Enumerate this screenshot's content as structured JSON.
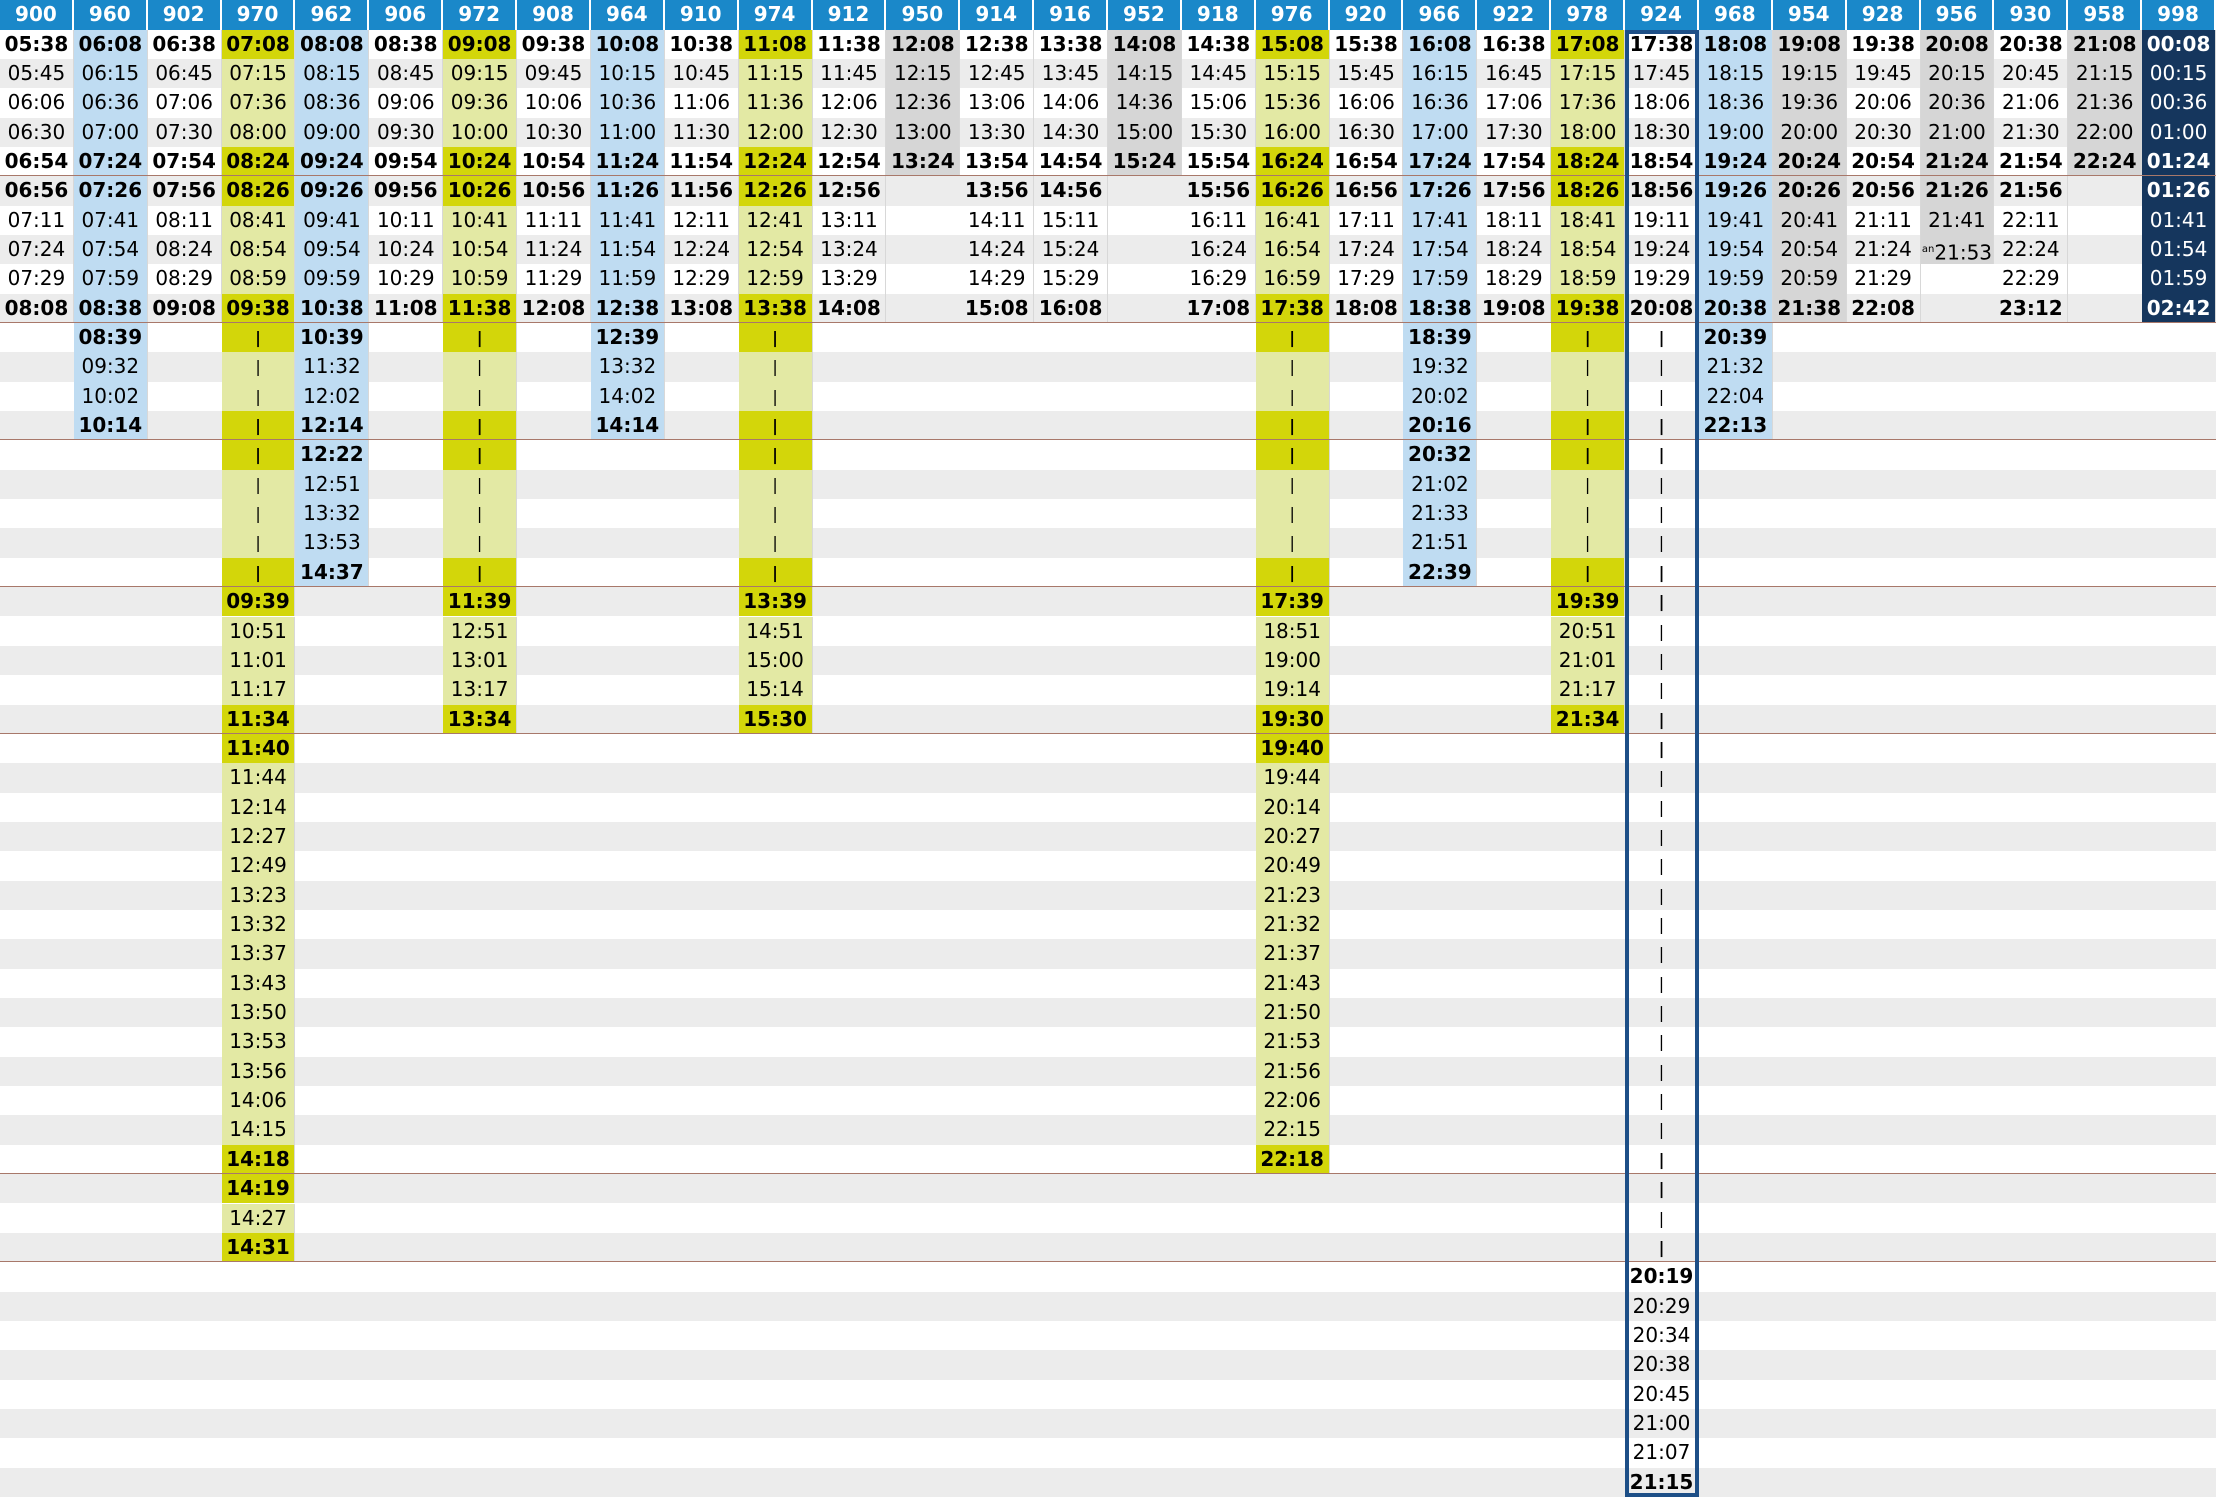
{
  "headers": [
    "900",
    "960",
    "902",
    "970",
    "962",
    "906",
    "972",
    "908",
    "964",
    "910",
    "974",
    "912",
    "950",
    "914",
    "916",
    "952",
    "918",
    "976",
    "920",
    "966",
    "922",
    "978",
    "924",
    "968",
    "954",
    "928",
    "956",
    "930",
    "958",
    "998"
  ],
  "column_styles": {
    "970": "yellow",
    "972": "yellow",
    "974": "yellow",
    "976": "yellow",
    "978": "yellow",
    "960": "lightblue",
    "962": "lightblue",
    "964": "lightblue",
    "966": "lightblue",
    "968": "lightblue",
    "950": "grey",
    "952": "grey",
    "954": "grey",
    "956": "grey",
    "958": "grey",
    "998": "navy"
  },
  "highlighted_column": "924",
  "colors": {
    "header_bg": "#1a88c9",
    "yellow_bold": "#d3d60a",
    "yellow_light": "#e3e9a4",
    "light_blue": "#bfdcf2",
    "grey": "#d6d6d6",
    "navy": "#15365d",
    "stripe": "#ececec",
    "separator": "#a8786a",
    "highlight_border": "#1d4f87"
  },
  "notes": {
    "an": "an"
  },
  "groups": [
    {
      "bold_last": true,
      "rows": [
        {
          "bold": true,
          "cells": {
            "900": "05:38",
            "960": "06:08",
            "902": "06:38",
            "970": "07:08",
            "962": "08:08",
            "906": "08:38",
            "972": "09:08",
            "908": "09:38",
            "964": "10:08",
            "910": "10:38",
            "974": "11:08",
            "912": "11:38",
            "950": "12:08",
            "914": "12:38",
            "916": "13:38",
            "952": "14:08",
            "918": "14:38",
            "976": "15:08",
            "920": "15:38",
            "966": "16:08",
            "922": "16:38",
            "978": "17:08",
            "924": "17:38",
            "968": "18:08",
            "954": "19:08",
            "928": "19:38",
            "956": "20:08",
            "930": "20:38",
            "958": "21:08",
            "998": "00:08"
          }
        },
        {
          "cells": {
            "900": "05:45",
            "960": "06:15",
            "902": "06:45",
            "970": "07:15",
            "962": "08:15",
            "906": "08:45",
            "972": "09:15",
            "908": "09:45",
            "964": "10:15",
            "910": "10:45",
            "974": "11:15",
            "912": "11:45",
            "950": "12:15",
            "914": "12:45",
            "916": "13:45",
            "952": "14:15",
            "918": "14:45",
            "976": "15:15",
            "920": "15:45",
            "966": "16:15",
            "922": "16:45",
            "978": "17:15",
            "924": "17:45",
            "968": "18:15",
            "954": "19:15",
            "928": "19:45",
            "956": "20:15",
            "930": "20:45",
            "958": "21:15",
            "998": "00:15"
          }
        },
        {
          "cells": {
            "900": "06:06",
            "960": "06:36",
            "902": "07:06",
            "970": "07:36",
            "962": "08:36",
            "906": "09:06",
            "972": "09:36",
            "908": "10:06",
            "964": "10:36",
            "910": "11:06",
            "974": "11:36",
            "912": "12:06",
            "950": "12:36",
            "914": "13:06",
            "916": "14:06",
            "952": "14:36",
            "918": "15:06",
            "976": "15:36",
            "920": "16:06",
            "966": "16:36",
            "922": "17:06",
            "978": "17:36",
            "924": "18:06",
            "968": "18:36",
            "954": "19:36",
            "928": "20:06",
            "956": "20:36",
            "930": "21:06",
            "958": "21:36",
            "998": "00:36"
          }
        },
        {
          "cells": {
            "900": "06:30",
            "960": "07:00",
            "902": "07:30",
            "970": "08:00",
            "962": "09:00",
            "906": "09:30",
            "972": "10:00",
            "908": "10:30",
            "964": "11:00",
            "910": "11:30",
            "974": "12:00",
            "912": "12:30",
            "950": "13:00",
            "914": "13:30",
            "916": "14:30",
            "952": "15:00",
            "918": "15:30",
            "976": "16:00",
            "920": "16:30",
            "966": "17:00",
            "922": "17:30",
            "978": "18:00",
            "924": "18:30",
            "968": "19:00",
            "954": "20:00",
            "928": "20:30",
            "956": "21:00",
            "930": "21:30",
            "958": "22:00",
            "998": "01:00"
          }
        },
        {
          "bold": true,
          "cells": {
            "900": "06:54",
            "960": "07:24",
            "902": "07:54",
            "970": "08:24",
            "962": "09:24",
            "906": "09:54",
            "972": "10:24",
            "908": "10:54",
            "964": "11:24",
            "910": "11:54",
            "974": "12:24",
            "912": "12:54",
            "950": "13:24",
            "914": "13:54",
            "916": "14:54",
            "952": "15:24",
            "918": "15:54",
            "976": "16:24",
            "920": "16:54",
            "966": "17:24",
            "922": "17:54",
            "978": "18:24",
            "924": "18:54",
            "968": "19:24",
            "954": "20:24",
            "928": "20:54",
            "956": "21:24",
            "930": "21:54",
            "958": "22:24",
            "998": "01:24"
          }
        }
      ]
    },
    {
      "rows": [
        {
          "bold": true,
          "cells": {
            "900": "06:56",
            "960": "07:26",
            "902": "07:56",
            "970": "08:26",
            "962": "09:26",
            "906": "09:56",
            "972": "10:26",
            "908": "10:56",
            "964": "11:26",
            "910": "11:56",
            "974": "12:26",
            "912": "12:56",
            "914": "13:56",
            "916": "14:56",
            "918": "15:56",
            "976": "16:26",
            "920": "16:56",
            "966": "17:26",
            "922": "17:56",
            "978": "18:26",
            "924": "18:56",
            "968": "19:26",
            "954": "20:26",
            "928": "20:56",
            "956": "21:26",
            "930": "21:56",
            "998": "01:26"
          }
        },
        {
          "cells": {
            "900": "07:11",
            "960": "07:41",
            "902": "08:11",
            "970": "08:41",
            "962": "09:41",
            "906": "10:11",
            "972": "10:41",
            "908": "11:11",
            "964": "11:41",
            "910": "12:11",
            "974": "12:41",
            "912": "13:11",
            "914": "14:11",
            "916": "15:11",
            "918": "16:11",
            "976": "16:41",
            "920": "17:11",
            "966": "17:41",
            "922": "18:11",
            "978": "18:41",
            "924": "19:11",
            "968": "19:41",
            "954": "20:41",
            "928": "21:11",
            "956": "21:41",
            "930": "22:11",
            "998": "01:41"
          }
        },
        {
          "cells": {
            "900": "07:24",
            "960": "07:54",
            "902": "08:24",
            "970": "08:54",
            "962": "09:54",
            "906": "10:24",
            "972": "10:54",
            "908": "11:24",
            "964": "11:54",
            "910": "12:24",
            "974": "12:54",
            "912": "13:24",
            "914": "14:24",
            "916": "15:24",
            "918": "16:24",
            "976": "16:54",
            "920": "17:24",
            "966": "17:54",
            "922": "18:24",
            "978": "18:54",
            "924": "19:24",
            "968": "19:54",
            "954": "20:54",
            "928": "21:24",
            "956": "21:53",
            "930": "22:24",
            "998": "01:54"
          },
          "notes": {
            "956": "an"
          }
        },
        {
          "cells": {
            "900": "07:29",
            "960": "07:59",
            "902": "08:29",
            "970": "08:59",
            "962": "09:59",
            "906": "10:29",
            "972": "10:59",
            "908": "11:29",
            "964": "11:59",
            "910": "12:29",
            "974": "12:59",
            "912": "13:29",
            "914": "14:29",
            "916": "15:29",
            "918": "16:29",
            "976": "16:59",
            "920": "17:29",
            "966": "17:59",
            "922": "18:29",
            "978": "18:59",
            "924": "19:29",
            "968": "19:59",
            "954": "20:59",
            "928": "21:29",
            "930": "22:29",
            "998": "01:59"
          }
        },
        {
          "bold": true,
          "cells": {
            "900": "08:08",
            "960": "08:38",
            "902": "09:08",
            "970": "09:38",
            "962": "10:38",
            "906": "11:08",
            "972": "11:38",
            "908": "12:08",
            "964": "12:38",
            "910": "13:08",
            "974": "13:38",
            "912": "14:08",
            "914": "15:08",
            "916": "16:08",
            "918": "17:08",
            "976": "17:38",
            "920": "18:08",
            "966": "18:38",
            "922": "19:08",
            "978": "19:38",
            "924": "20:08",
            "968": "20:38",
            "954": "21:38",
            "928": "22:08",
            "930": "23:12",
            "998": "02:42"
          }
        }
      ]
    },
    {
      "rows": [
        {
          "bold": true,
          "cells": {
            "960": "08:39",
            "970": "|",
            "962": "10:39",
            "972": "|",
            "964": "12:39",
            "974": "|",
            "976": "|",
            "966": "18:39",
            "978": "|",
            "924": "|",
            "968": "20:39"
          }
        },
        {
          "cells": {
            "960": "09:32",
            "970": "|",
            "962": "11:32",
            "972": "|",
            "964": "13:32",
            "974": "|",
            "976": "|",
            "966": "19:32",
            "978": "|",
            "924": "|",
            "968": "21:32"
          }
        },
        {
          "cells": {
            "960": "10:02",
            "970": "|",
            "962": "12:02",
            "972": "|",
            "964": "14:02",
            "974": "|",
            "976": "|",
            "966": "20:02",
            "978": "|",
            "924": "|",
            "968": "22:04"
          }
        },
        {
          "bold": true,
          "cells": {
            "960": "10:14",
            "970": "|",
            "962": "12:14",
            "972": "|",
            "964": "14:14",
            "974": "|",
            "976": "|",
            "966": "20:16",
            "978": "|",
            "924": "|",
            "968": "22:13"
          }
        }
      ]
    },
    {
      "rows": [
        {
          "bold": true,
          "cells": {
            "970": "|",
            "962": "12:22",
            "972": "|",
            "974": "|",
            "976": "|",
            "966": "20:32",
            "978": "|",
            "924": "|"
          }
        },
        {
          "cells": {
            "970": "|",
            "962": "12:51",
            "972": "|",
            "974": "|",
            "976": "|",
            "966": "21:02",
            "978": "|",
            "924": "|"
          }
        },
        {
          "cells": {
            "970": "|",
            "962": "13:32",
            "972": "|",
            "974": "|",
            "976": "|",
            "966": "21:33",
            "978": "|",
            "924": "|"
          }
        },
        {
          "cells": {
            "970": "|",
            "962": "13:53",
            "972": "|",
            "974": "|",
            "976": "|",
            "966": "21:51",
            "978": "|",
            "924": "|"
          }
        },
        {
          "bold": true,
          "cells": {
            "970": "|",
            "962": "14:37",
            "972": "|",
            "974": "|",
            "976": "|",
            "966": "22:39",
            "978": "|",
            "924": "|"
          }
        }
      ]
    },
    {
      "rows": [
        {
          "bold": true,
          "cells": {
            "970": "09:39",
            "972": "11:39",
            "974": "13:39",
            "976": "17:39",
            "978": "19:39",
            "924": "|"
          }
        },
        {
          "cells": {
            "970": "10:51",
            "972": "12:51",
            "974": "14:51",
            "976": "18:51",
            "978": "20:51",
            "924": "|"
          }
        },
        {
          "cells": {
            "970": "11:01",
            "972": "13:01",
            "974": "15:00",
            "976": "19:00",
            "978": "21:01",
            "924": "|"
          }
        },
        {
          "cells": {
            "970": "11:17",
            "972": "13:17",
            "974": "15:14",
            "976": "19:14",
            "978": "21:17",
            "924": "|"
          }
        },
        {
          "bold": true,
          "cells": {
            "970": "11:34",
            "972": "13:34",
            "974": "15:30",
            "976": "19:30",
            "978": "21:34",
            "924": "|"
          }
        }
      ]
    },
    {
      "rows": [
        {
          "bold": true,
          "cells": {
            "970": "11:40",
            "976": "19:40",
            "924": "|"
          }
        },
        {
          "cells": {
            "970": "11:44",
            "976": "19:44",
            "924": "|"
          }
        },
        {
          "cells": {
            "970": "12:14",
            "976": "20:14",
            "924": "|"
          }
        },
        {
          "cells": {
            "970": "12:27",
            "976": "20:27",
            "924": "|"
          }
        },
        {
          "cells": {
            "970": "12:49",
            "976": "20:49",
            "924": "|"
          }
        },
        {
          "cells": {
            "970": "13:23",
            "976": "21:23",
            "924": "|"
          }
        },
        {
          "cells": {
            "970": "13:32",
            "976": "21:32",
            "924": "|"
          }
        },
        {
          "cells": {
            "970": "13:37",
            "976": "21:37",
            "924": "|"
          }
        },
        {
          "cells": {
            "970": "13:43",
            "976": "21:43",
            "924": "|"
          }
        },
        {
          "cells": {
            "970": "13:50",
            "976": "21:50",
            "924": "|"
          }
        },
        {
          "cells": {
            "970": "13:53",
            "976": "21:53",
            "924": "|"
          }
        },
        {
          "cells": {
            "970": "13:56",
            "976": "21:56",
            "924": "|"
          }
        },
        {
          "cells": {
            "970": "14:06",
            "976": "22:06",
            "924": "|"
          }
        },
        {
          "cells": {
            "970": "14:15",
            "976": "22:15",
            "924": "|"
          }
        },
        {
          "bold": true,
          "cells": {
            "970": "14:18",
            "976": "22:18",
            "924": "|"
          }
        }
      ]
    },
    {
      "rows": [
        {
          "bold": true,
          "cells": {
            "970": "14:19",
            "924": "|"
          }
        },
        {
          "cells": {
            "970": "14:27",
            "924": "|"
          }
        },
        {
          "bold": true,
          "cells": {
            "970": "14:31",
            "924": "|"
          }
        }
      ]
    },
    {
      "rows": [
        {
          "bold": true,
          "cells": {
            "924": "20:19"
          }
        },
        {
          "cells": {
            "924": "20:29"
          }
        },
        {
          "cells": {
            "924": "20:34"
          }
        },
        {
          "cells": {
            "924": "20:38"
          }
        },
        {
          "cells": {
            "924": "20:45"
          }
        },
        {
          "cells": {
            "924": "21:00"
          }
        },
        {
          "cells": {
            "924": "21:07"
          }
        },
        {
          "bold": true,
          "cells": {
            "924": "21:15"
          }
        }
      ]
    }
  ]
}
